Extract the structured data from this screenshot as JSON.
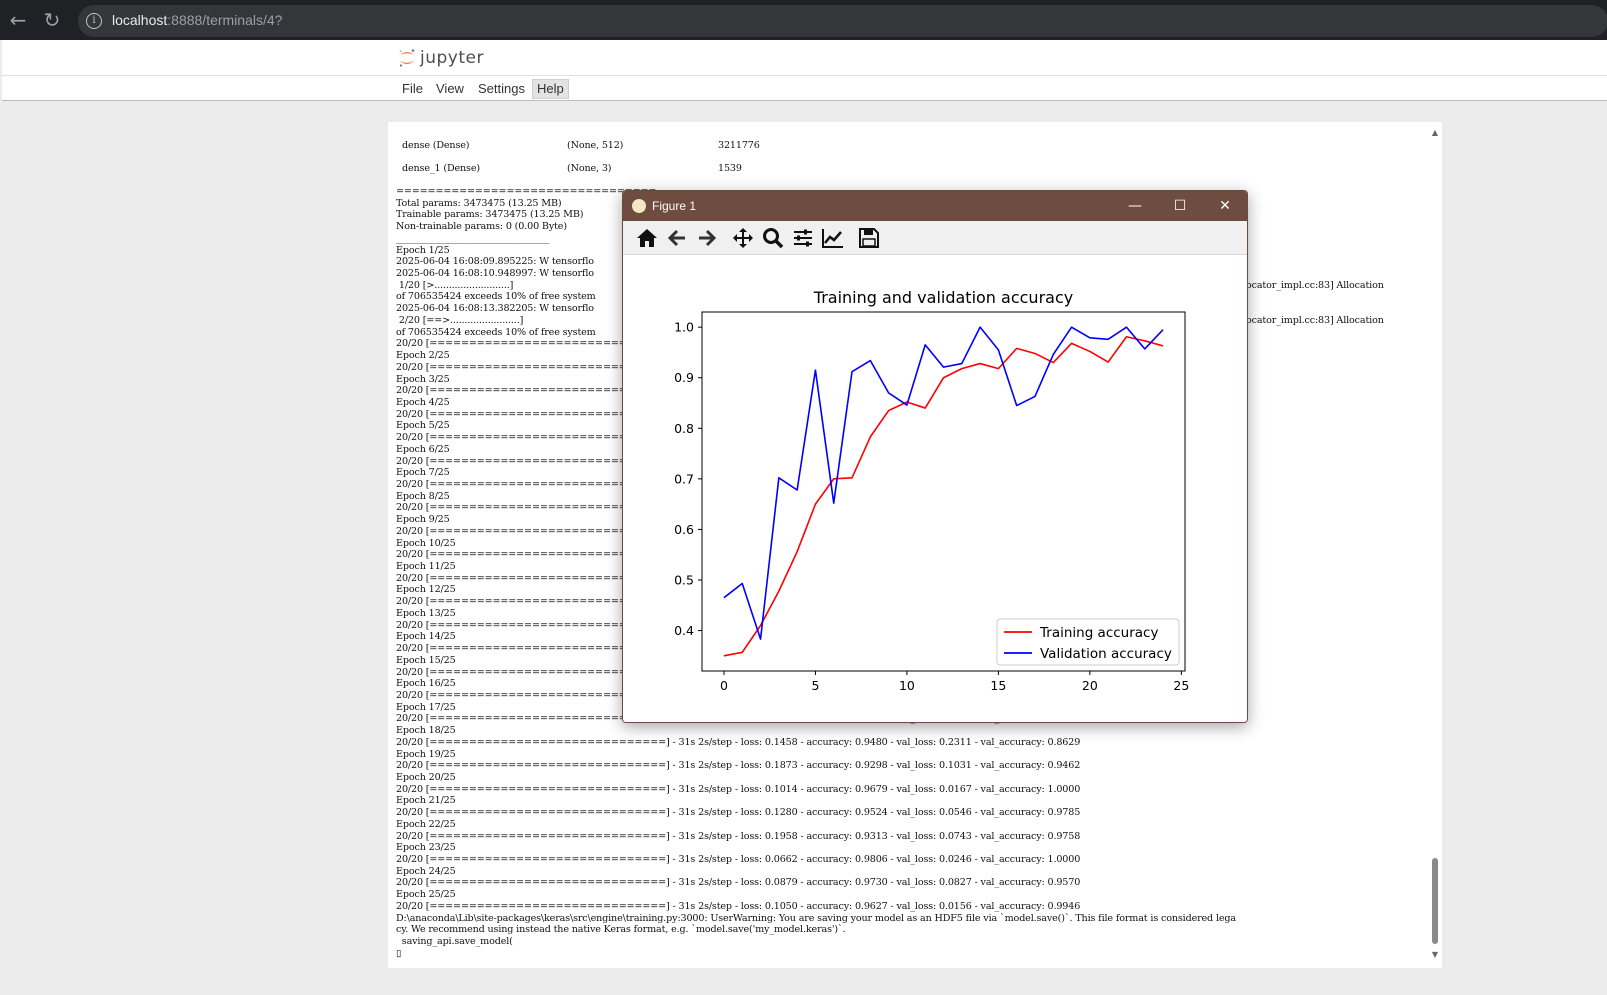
{
  "browser": {
    "url_host": "localhost",
    "url_path": ":8888/terminals/4?",
    "back_icon": "arrow-left-icon",
    "reload_icon": "reload-icon"
  },
  "jupyter": {
    "logo_text": "jupyter",
    "menu": [
      "File",
      "View",
      "Settings",
      "Help"
    ]
  },
  "terminal": {
    "lines_top": [
      {
        "col1": "dense (Dense)",
        "col2": "(None, 512)",
        "col3": "3211776"
      },
      {
        "col1": "dense_1 (Dense)",
        "col2": "(None, 3)",
        "col3": "1539"
      }
    ],
    "lines": [
      "=================================",
      "Total params: 3473475 (13.25 MB)",
      "Trainable params: 3473475 (13.25 MB)",
      "Non-trainable params: 0 (0.00 Byte)",
      "_________________________________",
      "Epoch 1/25",
      "2025-06-04 16:08:09.895225: W tensorflo",
      "2025-06-04 16:08:10.948997: W tensorflo",
      " 1/20 [>..........................]",
      "of 706535424 exceeds 10% of free system",
      "2025-06-04 16:08:13.382205: W tensorflo",
      " 2/20 [==>........................]",
      "of 706535424 exceeds 10% of free system",
      "20/20 [==============================]",
      "Epoch 2/25",
      "20/20 [==============================]",
      "Epoch 3/25",
      "20/20 [==============================]",
      "Epoch 4/25",
      "20/20 [==============================]",
      "Epoch 5/25",
      "20/20 [==============================]",
      "Epoch 6/25",
      "20/20 [==============================]",
      "Epoch 7/25",
      "20/20 [==============================]",
      "Epoch 8/25",
      "20/20 [==============================]",
      "Epoch 9/25",
      "20/20 [==============================]",
      "Epoch 10/25",
      "20/20 [==============================]",
      "Epoch 11/25",
      "20/20 [==============================]",
      "Epoch 12/25",
      "20/20 [==============================]",
      "Epoch 13/25",
      "20/20 [==============================]",
      "Epoch 14/25",
      "20/20 [==============================]",
      "Epoch 15/25",
      "20/20 [==============================]",
      "Epoch 16/25",
      "20/20 [==============================]",
      "Epoch 17/25",
      "20/20 [==============================] - 31s 2s/step - loss: 0.1458 - accuracy: 0.9480 - val_loss: 0.2311 - val_accuracy: 0.8629",
      "Epoch 18/25",
      "20/20 [==============================] - 31s 2s/step - loss: 0.1458 - accuracy: 0.9480 - val_loss: 0.2311 - val_accuracy: 0.8629",
      "Epoch 19/25",
      "20/20 [==============================] - 31s 2s/step - loss: 0.1873 - accuracy: 0.9298 - val_loss: 0.1031 - val_accuracy: 0.9462",
      "Epoch 20/25",
      "20/20 [==============================] - 31s 2s/step - loss: 0.1014 - accuracy: 0.9679 - val_loss: 0.0167 - val_accuracy: 1.0000",
      "Epoch 21/25",
      "20/20 [==============================] - 31s 2s/step - loss: 0.1280 - accuracy: 0.9524 - val_loss: 0.0546 - val_accuracy: 0.9785",
      "Epoch 22/25",
      "20/20 [==============================] - 31s 2s/step - loss: 0.1958 - accuracy: 0.9313 - val_loss: 0.0743 - val_accuracy: 0.9758",
      "Epoch 23/25",
      "20/20 [==============================] - 31s 2s/step - loss: 0.0662 - accuracy: 0.9806 - val_loss: 0.0246 - val_accuracy: 1.0000",
      "Epoch 24/25",
      "20/20 [==============================] - 31s 2s/step - loss: 0.0879 - accuracy: 0.9730 - val_loss: 0.0827 - val_accuracy: 0.9570",
      "Epoch 25/25",
      "20/20 [==============================] - 31s 2s/step - loss: 0.1050 - accuracy: 0.9627 - val_loss: 0.0156 - val_accuracy: 0.9946",
      "D:\\anaconda\\Lib\\site-packages\\keras\\src\\engine\\training.py:3000: UserWarning: You are saving your model as an HDF5 file via `model.save()`. This file format is considered lega",
      "cy. We recommend using instead the native Keras format, e.g. `model.save('my_model.keras')`.",
      "  saving_api.save_model(",
      "▯"
    ],
    "right_fragments": [
      "ocator_impl.cc:83] Allocation",
      "ocator_impl.cc:83] Allocation"
    ]
  },
  "figure": {
    "window_title": "Figure 1",
    "minimize": "—",
    "maximize": "☐",
    "close": "✕",
    "tools": [
      "home-icon",
      "back-arrow-icon",
      "forward-arrow-icon",
      "pan-icon",
      "zoom-icon",
      "configure-subplots-icon",
      "edit-axis-icon",
      "save-icon"
    ]
  },
  "chart_data": {
    "type": "line",
    "title": "Training and validation accuracy",
    "xlabel": "",
    "ylabel": "",
    "xlim": [
      -1.2,
      25.2
    ],
    "ylim": [
      0.32,
      1.03
    ],
    "xticks": [
      0,
      5,
      10,
      15,
      20,
      25
    ],
    "yticks": [
      0.4,
      0.5,
      0.6,
      0.7,
      0.8,
      0.9,
      1.0
    ],
    "ytick_labels": [
      "0.4",
      "0.5",
      "0.6",
      "0.7",
      "0.8",
      "0.9",
      "1.0"
    ],
    "legend_position": "lower-right",
    "x": [
      0,
      1,
      2,
      3,
      4,
      5,
      6,
      7,
      8,
      9,
      10,
      11,
      12,
      13,
      14,
      15,
      16,
      17,
      18,
      19,
      20,
      21,
      22,
      23,
      24
    ],
    "series": [
      {
        "name": "Training accuracy",
        "color": "#ff0000",
        "values": [
          0.35,
          0.357,
          0.41,
          0.478,
          0.556,
          0.65,
          0.7,
          0.702,
          0.783,
          0.835,
          0.852,
          0.84,
          0.9,
          0.918,
          0.928,
          0.918,
          0.958,
          0.948,
          0.93,
          0.968,
          0.952,
          0.931,
          0.981,
          0.973,
          0.963
        ]
      },
      {
        "name": "Validation accuracy",
        "color": "#0000ff",
        "values": [
          0.465,
          0.493,
          0.383,
          0.702,
          0.678,
          0.915,
          0.652,
          0.912,
          0.934,
          0.87,
          0.846,
          0.965,
          0.921,
          0.928,
          1.0,
          0.955,
          0.845,
          0.863,
          0.946,
          1.0,
          0.979,
          0.976,
          1.0,
          0.957,
          0.995
        ]
      }
    ]
  }
}
